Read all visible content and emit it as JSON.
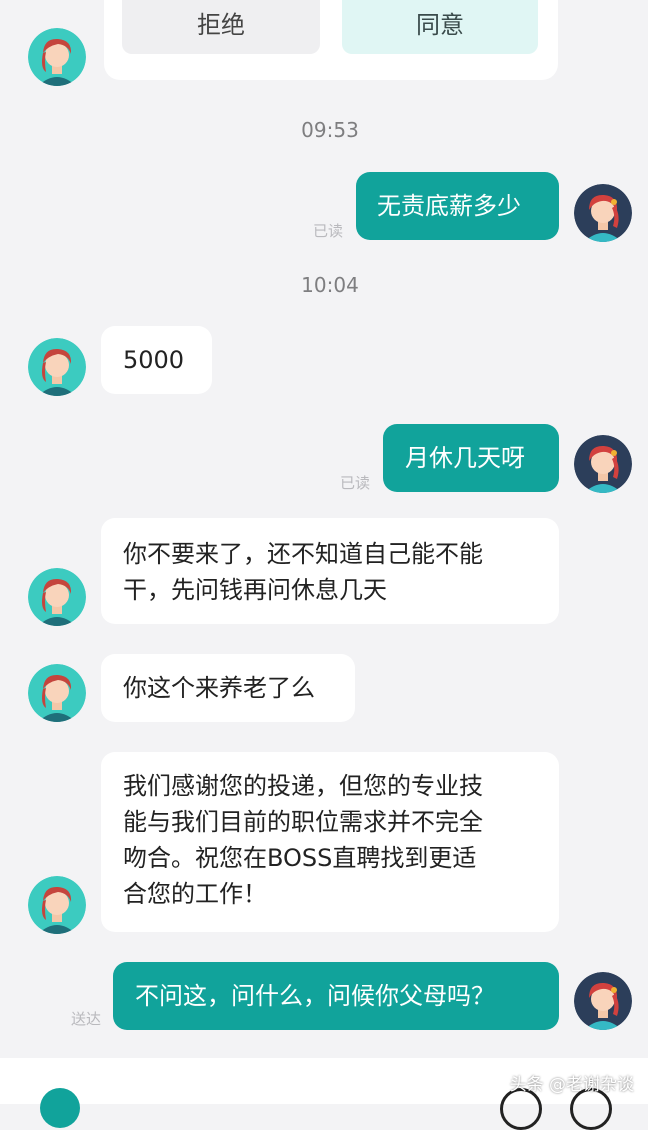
{
  "colors": {
    "accent": "#11a39b",
    "incoming_bg": "#ffffff",
    "page_bg": "#f3f3f5"
  },
  "action_card": {
    "reject_label": "拒绝",
    "agree_label": "同意"
  },
  "timestamps": [
    "09:53",
    "10:04"
  ],
  "messages": [
    {
      "side": "out",
      "text": "无责底薪多少",
      "status": "已读"
    },
    {
      "side": "in",
      "text": "5000"
    },
    {
      "side": "out",
      "text": "月休几天呀",
      "status": "已读"
    },
    {
      "side": "in",
      "lines": [
        "你不要来了，还不知道自己能不能",
        "干，先问钱再问休息几天"
      ]
    },
    {
      "side": "in",
      "text": "你这个来养老了么"
    },
    {
      "side": "in",
      "lines": [
        "我们感谢您的投递，但您的专业技",
        "能与我们目前的职位需求并不完全",
        "吻合。祝您在BOSS直聘找到更适",
        "合您的工作！"
      ]
    },
    {
      "side": "out",
      "text": "不问这，问什么，问候你父母吗？",
      "status": "送达"
    }
  ],
  "watermark": "头条 @老谢杂谈"
}
